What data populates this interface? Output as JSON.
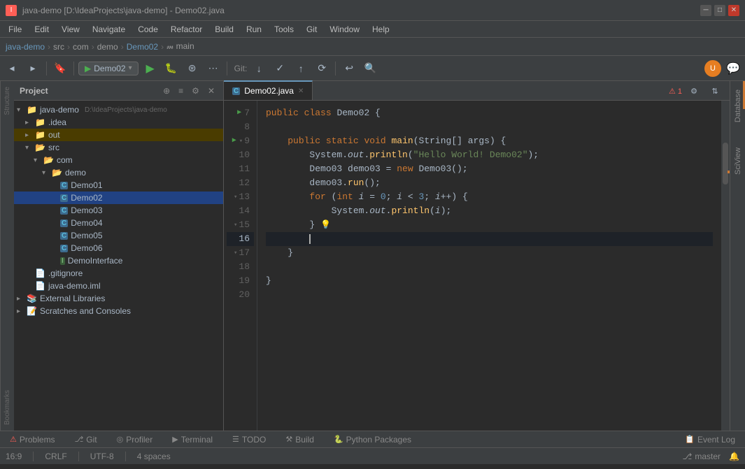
{
  "titlebar": {
    "app_name": "java-demo",
    "project_path": "D:\\IdeaProjects\\java-demo",
    "file_name": "Demo02.java",
    "title": "java-demo [D:\\IdeaProjects\\java-demo] - Demo02.java"
  },
  "menubar": {
    "items": [
      "File",
      "Edit",
      "View",
      "Navigate",
      "Code",
      "Refactor",
      "Build",
      "Run",
      "Tools",
      "Git",
      "Window",
      "Help"
    ]
  },
  "breadcrumb": {
    "items": [
      "java-demo",
      "src",
      "com",
      "demo",
      "Demo02",
      "main"
    ]
  },
  "toolbar": {
    "run_config": "Demo02",
    "git_label": "Git:"
  },
  "project": {
    "title": "Project",
    "tree": [
      {
        "label": "java-demo",
        "path": "D:\\IdeaProjects\\java-demo",
        "indent": 0,
        "type": "project",
        "expanded": true
      },
      {
        "label": ".idea",
        "indent": 1,
        "type": "folder",
        "expanded": false
      },
      {
        "label": "out",
        "indent": 1,
        "type": "folder",
        "expanded": false,
        "highlighted": true
      },
      {
        "label": "src",
        "indent": 1,
        "type": "folder",
        "expanded": true
      },
      {
        "label": "com",
        "indent": 2,
        "type": "folder",
        "expanded": true
      },
      {
        "label": "demo",
        "indent": 3,
        "type": "folder",
        "expanded": true
      },
      {
        "label": "Demo01",
        "indent": 4,
        "type": "java"
      },
      {
        "label": "Demo02",
        "indent": 4,
        "type": "java",
        "selected": true
      },
      {
        "label": "Demo03",
        "indent": 4,
        "type": "java"
      },
      {
        "label": "Demo04",
        "indent": 4,
        "type": "java"
      },
      {
        "label": "Demo05",
        "indent": 4,
        "type": "java"
      },
      {
        "label": "Demo06",
        "indent": 4,
        "type": "java"
      },
      {
        "label": "DemoInterface",
        "indent": 4,
        "type": "java-green"
      },
      {
        "label": ".gitignore",
        "indent": 1,
        "type": "file"
      },
      {
        "label": "java-demo.iml",
        "indent": 1,
        "type": "file"
      },
      {
        "label": "External Libraries",
        "indent": 0,
        "type": "folder-ext",
        "expanded": false
      },
      {
        "label": "Scratches and Consoles",
        "indent": 0,
        "type": "folder-scratch",
        "expanded": false
      }
    ]
  },
  "editor": {
    "tab_name": "Demo02.java",
    "error_count": "1",
    "lines": [
      {
        "num": 7,
        "content": "public class Demo02 {",
        "tokens": [
          {
            "t": "kw",
            "v": "public"
          },
          {
            "t": "plain",
            "v": " "
          },
          {
            "t": "kw",
            "v": "class"
          },
          {
            "t": "plain",
            "v": " Demo02 {"
          }
        ],
        "run_btn": true
      },
      {
        "num": 8,
        "content": "",
        "tokens": []
      },
      {
        "num": 9,
        "content": "    public static void main(String[] args) {",
        "tokens": [
          {
            "t": "plain",
            "v": "        "
          },
          {
            "t": "kw",
            "v": "public"
          },
          {
            "t": "plain",
            "v": " "
          },
          {
            "t": "kw",
            "v": "static"
          },
          {
            "t": "plain",
            "v": " "
          },
          {
            "t": "kw",
            "v": "void"
          },
          {
            "t": "plain",
            "v": " "
          },
          {
            "t": "method",
            "v": "main"
          },
          {
            "t": "plain",
            "v": "("
          },
          {
            "t": "type",
            "v": "String"
          },
          {
            "t": "plain",
            "v": "[] args) {"
          }
        ],
        "run_btn": true,
        "fold_btn": true
      },
      {
        "num": 10,
        "content": "        System.out.println(\"Hello World! Demo02\");",
        "tokens": [
          {
            "t": "plain",
            "v": "            System."
          },
          {
            "t": "italic",
            "v": "out"
          },
          {
            "t": "plain",
            "v": "."
          },
          {
            "t": "method",
            "v": "println"
          },
          {
            "t": "plain",
            "v": "("
          },
          {
            "t": "str",
            "v": "\"Hello World! Demo02\""
          },
          {
            "t": "plain",
            "v": ");"
          }
        ]
      },
      {
        "num": 11,
        "content": "        Demo03 demo03 = new Demo03();",
        "tokens": [
          {
            "t": "plain",
            "v": "            Demo03 demo03 = "
          },
          {
            "t": "kw",
            "v": "new"
          },
          {
            "t": "plain",
            "v": " Demo03();"
          }
        ]
      },
      {
        "num": 12,
        "content": "        demo03.run();",
        "tokens": [
          {
            "t": "plain",
            "v": "            demo03."
          },
          {
            "t": "method",
            "v": "run"
          },
          {
            "t": "plain",
            "v": "();"
          }
        ]
      },
      {
        "num": 13,
        "content": "        for (int i = 0; i < 3; i++) {",
        "tokens": [
          {
            "t": "plain",
            "v": "            "
          },
          {
            "t": "kw",
            "v": "for"
          },
          {
            "t": "plain",
            "v": " ("
          },
          {
            "t": "kw",
            "v": "int"
          },
          {
            "t": "plain",
            "v": " i = "
          },
          {
            "t": "num",
            "v": "0"
          },
          {
            "t": "plain",
            "v": "; i < "
          },
          {
            "t": "num",
            "v": "3"
          },
          {
            "t": "plain",
            "v": "; i++) {"
          }
        ],
        "fold_btn": true
      },
      {
        "num": 14,
        "content": "            System.out.println(i);",
        "tokens": [
          {
            "t": "plain",
            "v": "                System."
          },
          {
            "t": "italic",
            "v": "out"
          },
          {
            "t": "plain",
            "v": "."
          },
          {
            "t": "method",
            "v": "println"
          },
          {
            "t": "plain",
            "v": "(i);"
          }
        ]
      },
      {
        "num": 15,
        "content": "        }",
        "tokens": [
          {
            "t": "plain",
            "v": "            }"
          }
        ],
        "fold_btn": true,
        "lightbulb": true
      },
      {
        "num": 16,
        "content": "        ",
        "tokens": [],
        "active": true,
        "cursor": true
      },
      {
        "num": 17,
        "content": "    }",
        "tokens": [
          {
            "t": "plain",
            "v": "        }"
          }
        ],
        "fold_btn": true
      },
      {
        "num": 18,
        "content": "",
        "tokens": []
      },
      {
        "num": 19,
        "content": "}",
        "tokens": [
          {
            "t": "plain",
            "v": "}"
          }
        ]
      },
      {
        "num": 20,
        "content": "",
        "tokens": []
      }
    ]
  },
  "statusbar": {
    "position": "16:9",
    "line_ending": "CRLF",
    "encoding": "UTF-8",
    "indent": "4 spaces",
    "branch": "master"
  },
  "bottom_tools": {
    "items": [
      {
        "icon": "⚠",
        "label": "Problems"
      },
      {
        "icon": "⎇",
        "label": "Git"
      },
      {
        "icon": "◎",
        "label": "Profiler"
      },
      {
        "icon": "▶",
        "label": "Terminal"
      },
      {
        "icon": "☰",
        "label": "TODO"
      },
      {
        "icon": "⚒",
        "label": "Build"
      },
      {
        "icon": "🐍",
        "label": "Python Packages"
      }
    ],
    "event_log": "Event Log"
  },
  "right_panels": {
    "database": "Database",
    "sciview": "SciView"
  },
  "left_panels": {
    "structure": "Structure",
    "bookmarks": "Bookmarks"
  }
}
